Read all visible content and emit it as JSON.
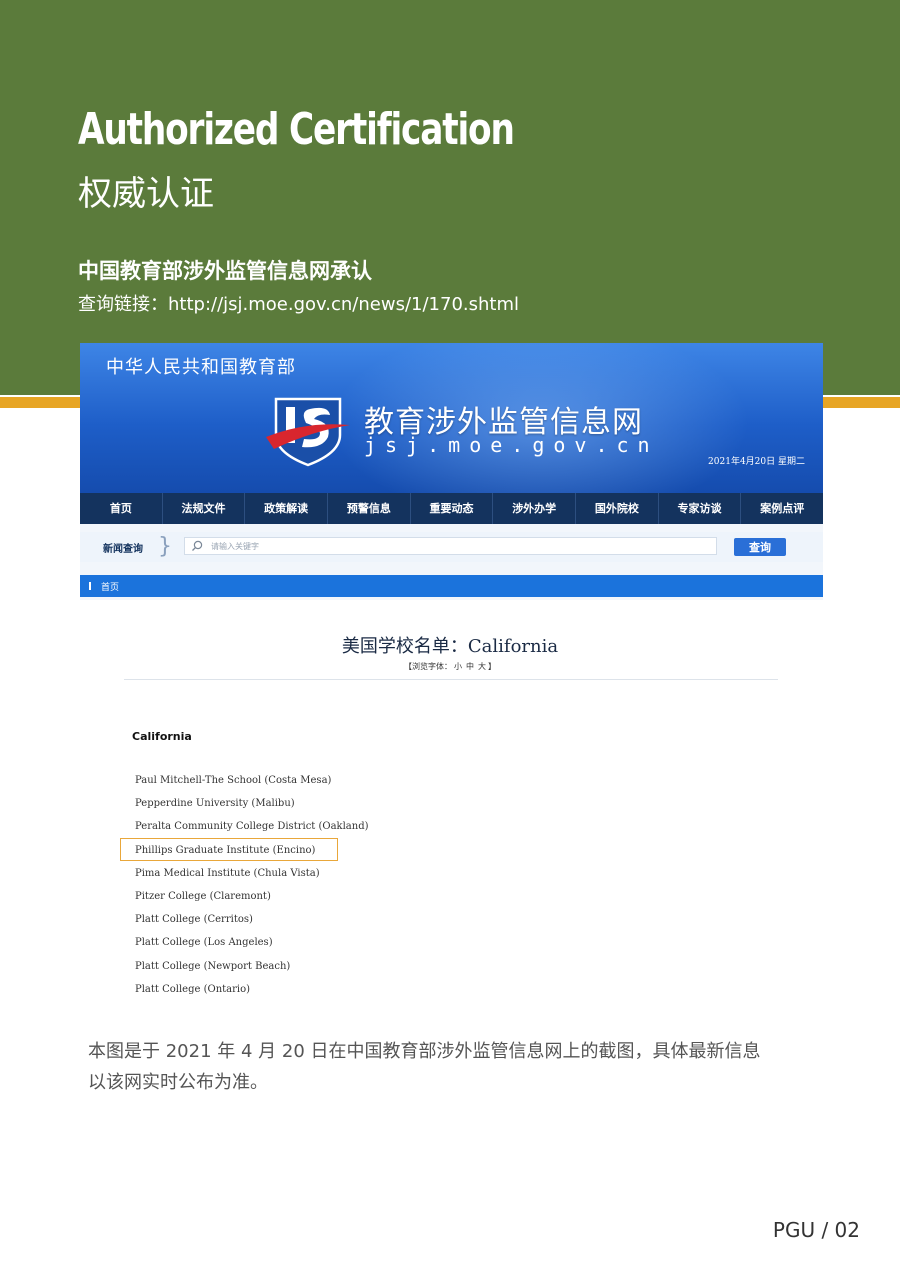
{
  "header": {
    "title_en": "Authorized Certification",
    "title_zh": "权威认证",
    "subtitle": "中国教育部涉外监管信息网承认",
    "query_link": "查询链接：http://jsj.moe.gov.cn/news/1/170.shtml"
  },
  "screenshot": {
    "ministry": "中华人民共和国教育部",
    "site_name": "教育涉外监管信息网",
    "site_url": "jsj.moe.gov.cn",
    "date": "2021年4月20日 星期二",
    "nav": [
      "首页",
      "法规文件",
      "政策解读",
      "预警信息",
      "重要动态",
      "涉外办学",
      "国外院校",
      "专家访谈",
      "案例点评"
    ],
    "search": {
      "label": "新闻查询",
      "placeholder": "请输入关键字",
      "button": "查询"
    },
    "breadcrumb": "首页"
  },
  "list": {
    "title": "美国学校名单：California",
    "font_size_prefix": "【浏览字体：",
    "font_small": "小",
    "font_medium": "中",
    "font_large": "大",
    "font_size_suffix": "】",
    "state": "California",
    "schools": [
      "Paul Mitchell-The School (Costa Mesa)",
      "Pepperdine University (Malibu)",
      "Peralta Community College District (Oakland)",
      "Phillips Graduate Institute (Encino)",
      "Pima Medical Institute (Chula Vista)",
      "Pitzer College (Claremont)",
      "Platt College (Cerritos)",
      "Platt College (Los Angeles)",
      "Platt College (Newport Beach)",
      "Platt College (Ontario)"
    ]
  },
  "caption_line1": "本图是于 2021 年 4 月 20 日在中国教育部涉外监管信息网上的截图，具体最新信息",
  "caption_line2": "以该网实时公布为准。",
  "page_number": "PGU / 02",
  "colors": {
    "green_band": "#5b7b3b",
    "gold_accent": "#e7a525",
    "nav_dark": "#14335e",
    "banner_blue": "#1e5ec8",
    "highlight_border": "#e9a73a"
  }
}
